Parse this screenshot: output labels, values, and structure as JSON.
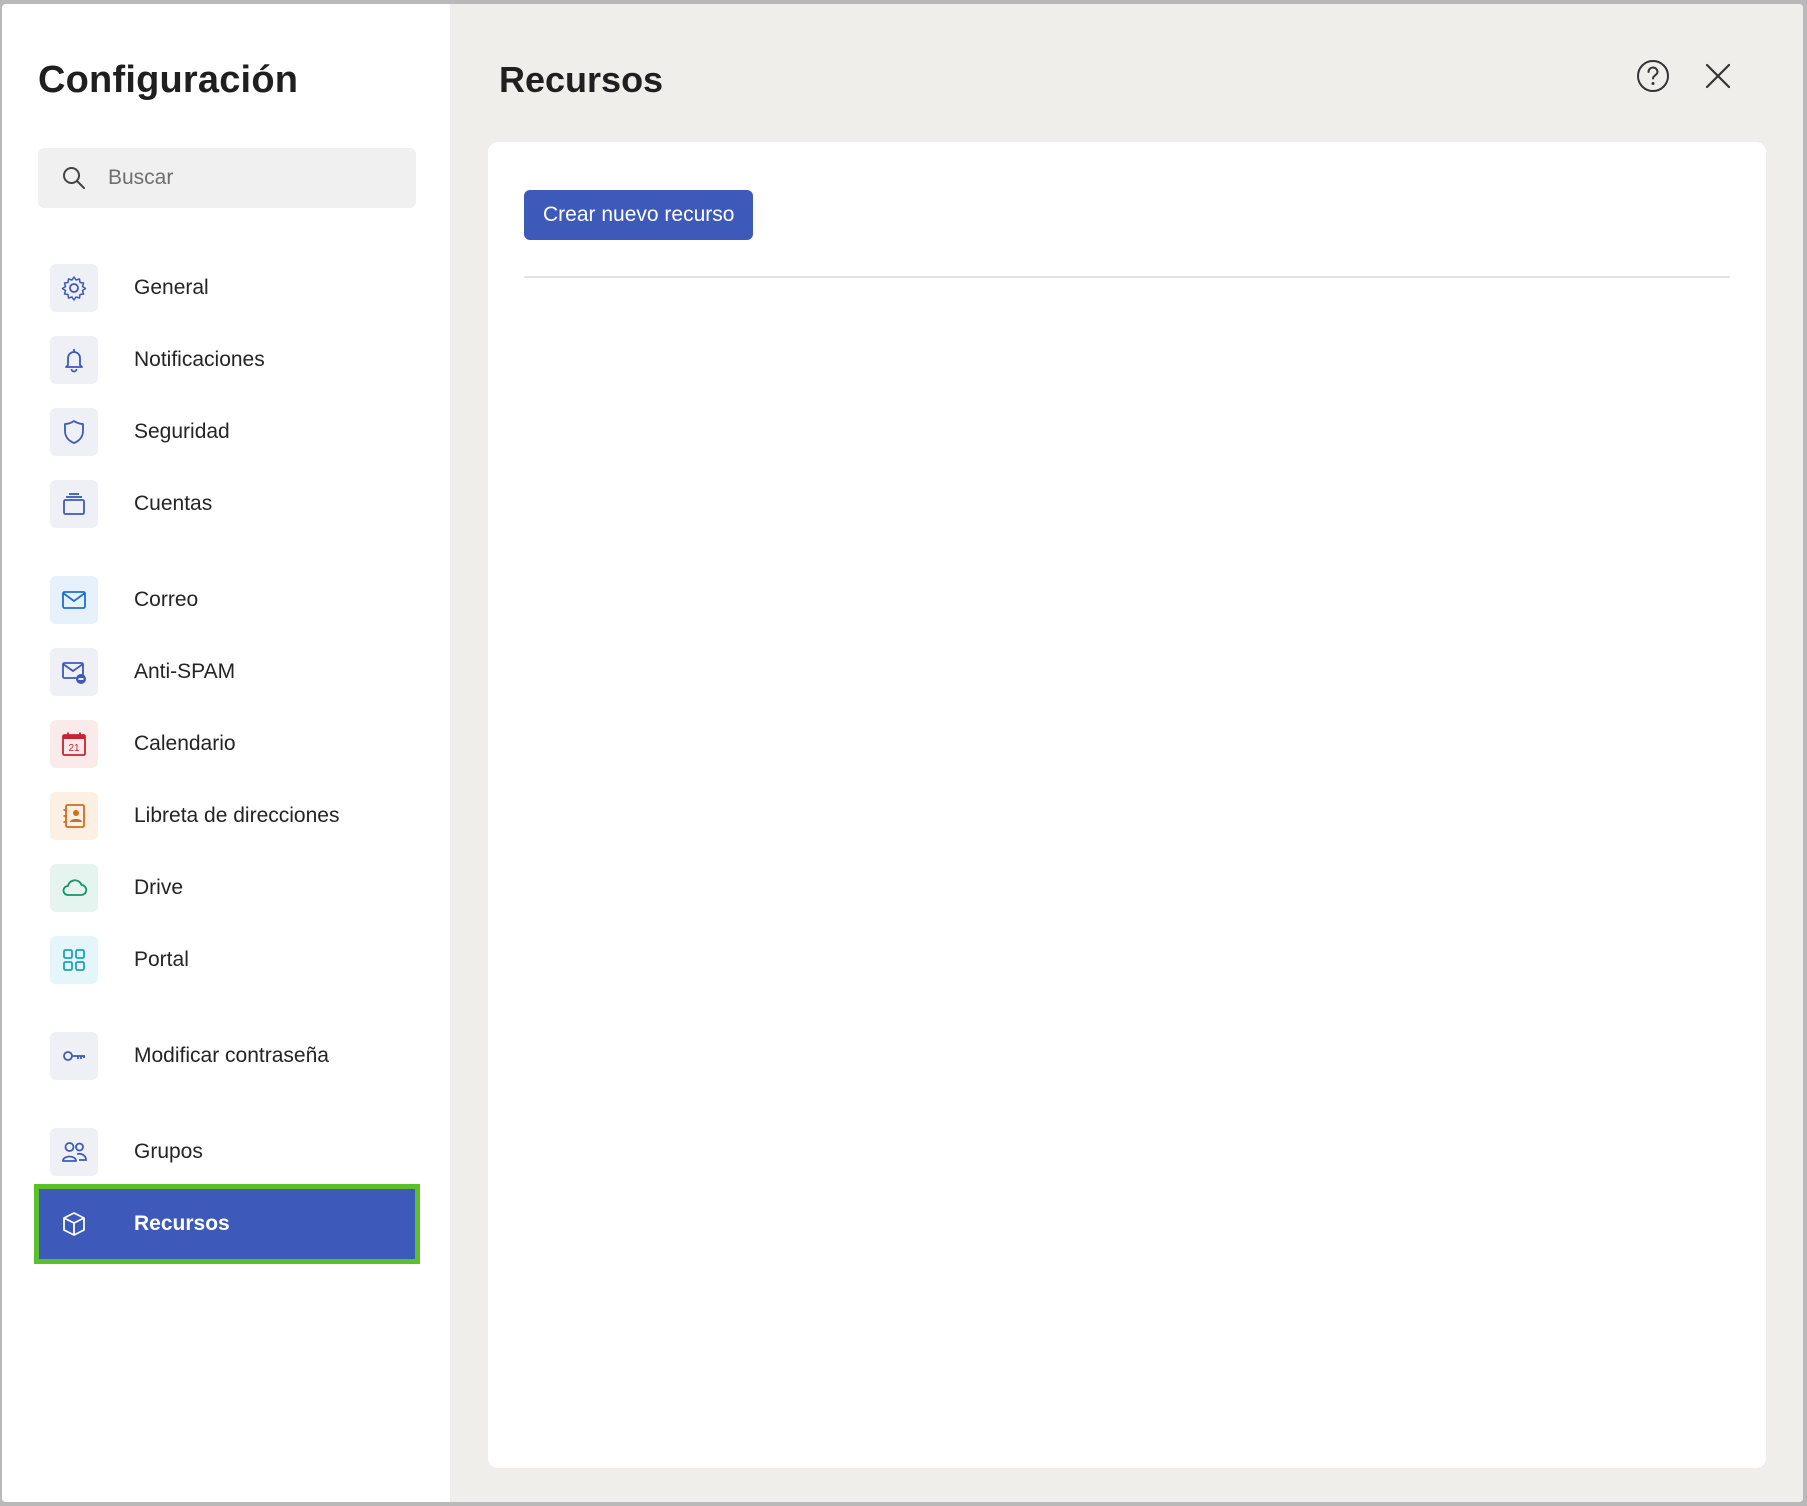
{
  "sidebar": {
    "title": "Configuración",
    "search": {
      "placeholder": "Buscar",
      "value": ""
    },
    "items": [
      {
        "label": "General",
        "icon": "gear-icon"
      },
      {
        "label": "Notificaciones",
        "icon": "bell-icon"
      },
      {
        "label": "Seguridad",
        "icon": "shield-icon"
      },
      {
        "label": "Cuentas",
        "icon": "accounts-icon"
      },
      {
        "label": "Correo",
        "icon": "mail-icon"
      },
      {
        "label": "Anti-SPAM",
        "icon": "mail-block-icon"
      },
      {
        "label": "Calendario",
        "icon": "calendar-icon",
        "icon_text": "21"
      },
      {
        "label": "Libreta de direcciones",
        "icon": "address-book-icon"
      },
      {
        "label": "Drive",
        "icon": "cloud-icon"
      },
      {
        "label": "Portal",
        "icon": "grid-icon"
      },
      {
        "label": "Modificar contraseña",
        "icon": "key-icon"
      },
      {
        "label": "Grupos",
        "icon": "people-icon"
      },
      {
        "label": "Recursos",
        "icon": "cube-icon",
        "active": true
      }
    ]
  },
  "main": {
    "title": "Recursos",
    "create_button_label": "Crear nuevo recurso"
  },
  "colors": {
    "accent": "#3d59b9",
    "highlight_border": "#5bc12a",
    "main_background": "#efeeeb"
  }
}
